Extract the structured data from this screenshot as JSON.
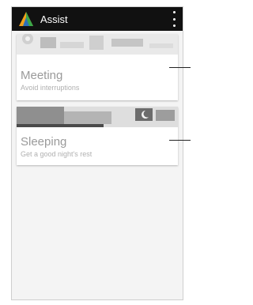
{
  "app": {
    "title": "Assist"
  },
  "cards": [
    {
      "title": "Meeting",
      "subtitle": "Avoid interruptions"
    },
    {
      "title": "Sleeping",
      "subtitle": "Get a good night's rest"
    }
  ],
  "icons": {
    "app_logo": "assist-logo-icon",
    "menu": "overflow-menu-icon"
  },
  "colors": {
    "appbar": "#111111",
    "logo_orange": "#f0a11a",
    "logo_green": "#3aa84a",
    "logo_blue": "#2d6fb7"
  }
}
